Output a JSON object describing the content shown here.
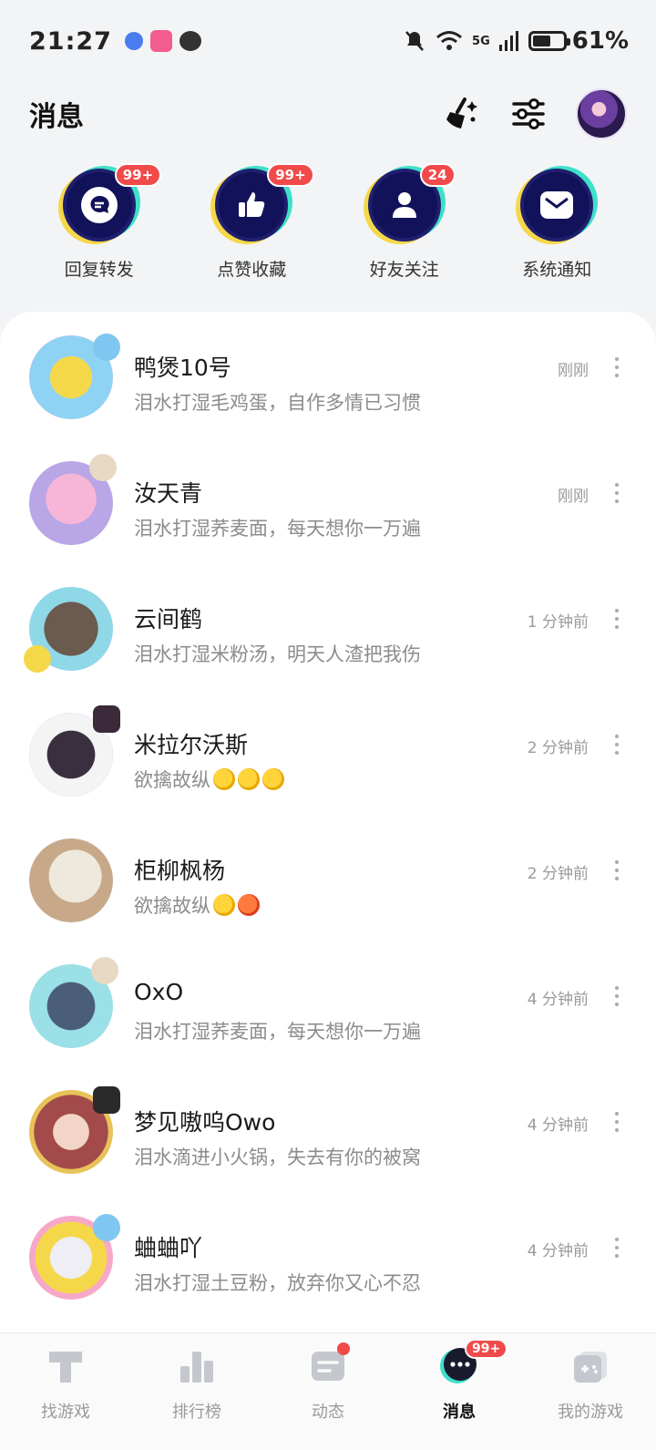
{
  "status_bar": {
    "time": "21:27",
    "network": "5G",
    "battery": "61%",
    "battery_level": 0.61
  },
  "header": {
    "title": "消息"
  },
  "categories": [
    {
      "label": "回复转发",
      "badge": "99+",
      "icon": "chat-bubble-icon"
    },
    {
      "label": "点赞收藏",
      "badge": "99+",
      "icon": "thumbs-up-icon"
    },
    {
      "label": "好友关注",
      "badge": "24",
      "icon": "person-icon"
    },
    {
      "label": "系统通知",
      "badge": "",
      "icon": "mail-icon"
    }
  ],
  "conversations": [
    {
      "name": "鸭煲10号",
      "message": "泪水打湿毛鸡蛋，自作多情已习惯",
      "time": "刚刚"
    },
    {
      "name": "汝天青",
      "message": "泪水打湿荞麦面，每天想你一万遍",
      "time": "刚刚"
    },
    {
      "name": "云间鹤",
      "message": "泪水打湿米粉汤，明天人渣把我伤",
      "time": "1 分钟前"
    },
    {
      "name": "米拉尔沃斯",
      "message": "欲擒故纵",
      "time": "2 分钟前",
      "emojis": [
        "fist",
        "fist",
        "fist"
      ]
    },
    {
      "name": "柜柳枫杨",
      "message": "欲擒故纵",
      "time": "2 分钟前",
      "emojis": [
        "fist",
        "angry"
      ]
    },
    {
      "name": "OxO",
      "message": "泪水打湿荞麦面，每天想你一万遍",
      "time": "4 分钟前"
    },
    {
      "name": "梦见嗷呜Owo",
      "message": "泪水滴进小火锅，失去有你的被窝",
      "time": "4 分钟前"
    },
    {
      "name": "蛐蛐吖",
      "message": "泪水打湿土豆粉，放弃你又心不忍",
      "time": "4 分钟前"
    }
  ],
  "bottom_nav": [
    {
      "label": "找游戏",
      "icon": "find-game-icon"
    },
    {
      "label": "排行榜",
      "icon": "ranking-icon"
    },
    {
      "label": "动态",
      "icon": "feed-icon"
    },
    {
      "label": "消息",
      "icon": "message-icon",
      "badge": "99+",
      "active": true
    },
    {
      "label": "我的游戏",
      "icon": "my-games-icon"
    }
  ]
}
